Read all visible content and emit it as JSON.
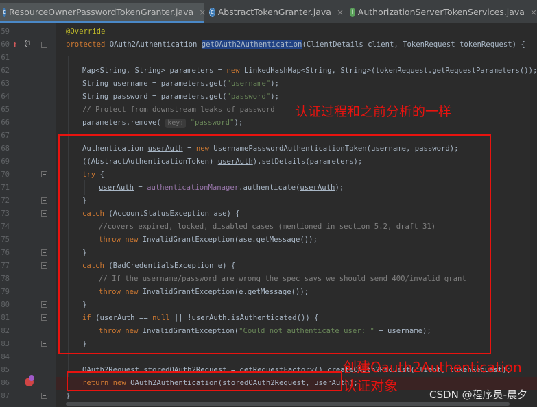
{
  "tabs": [
    {
      "label": "ResourceOwnerPasswordTokenGranter.java",
      "icon": "java-class-icon",
      "active": true
    },
    {
      "label": "AbstractTokenGranter.java",
      "icon": "java-abstract-class-icon",
      "active": false
    },
    {
      "label": "AuthorizationServerTokenServices.java",
      "icon": "java-interface-icon",
      "active": false
    }
  ],
  "close_glyph": "×",
  "line_numbers": [
    "59",
    "60",
    "61",
    "62",
    "63",
    "64",
    "65",
    "66",
    "67",
    "68",
    "69",
    "70",
    "71",
    "72",
    "73",
    "74",
    "75",
    "76",
    "77",
    "78",
    "79",
    "80",
    "81",
    "82",
    "83",
    "84",
    "85",
    "86",
    "87"
  ],
  "code": {
    "l59": "@Override",
    "l60_kw": "protected",
    "l60_type": " OAuth2Authentication ",
    "l60_method": "getOAuth2Authentication",
    "l60_rest": "(ClientDetails client, TokenRequest tokenRequest) {",
    "l62_a": "Map<String, String> parameters = ",
    "l62_kw": "new",
    "l62_b": " LinkedHashMap<String, String>(tokenRequest.getRequestParameters());",
    "l63_a": "String username = parameters.get(",
    "l63_str": "\"username\"",
    "l63_b": ");",
    "l64_a": "String password = parameters.get(",
    "l64_str": "\"password\"",
    "l64_b": ");",
    "l65_cmt": "// Protect from downstream leaks of password",
    "l66_a": "parameters.remove( ",
    "l66_hint": "key:",
    "l66_str": " \"password\"",
    "l66_b": ");",
    "l68_a": "Authentication ",
    "l68_var": "userAuth",
    "l68_b": " = ",
    "l68_kw": "new",
    "l68_c": " UsernamePasswordAuthenticationToken(username, password);",
    "l69_a": "((AbstractAuthenticationToken) ",
    "l69_var": "userAuth",
    "l69_b": ").setDetails(parameters);",
    "l70_kw": "try",
    "l70_b": " {",
    "l71_var": "userAuth",
    "l71_a": " = ",
    "l71_fld": "authenticationManager",
    "l71_b": ".authenticate(",
    "l71_var2": "userAuth",
    "l71_c": ");",
    "l72": "}",
    "l73_kw": "catch",
    "l73_b": " (AccountStatusException ase) {",
    "l74_cmt": "//covers expired, locked, disabled cases (mentioned in section 5.2, draft 31)",
    "l75_kw": "throw new",
    "l75_b": " InvalidGrantException(ase.getMessage());",
    "l76": "}",
    "l77_kw": "catch",
    "l77_b": " (BadCredentialsException e) {",
    "l78_cmt": "// If the username/password are wrong the spec says we should send 400/invalid grant",
    "l79_kw": "throw new",
    "l79_b": " InvalidGrantException(e.getMessage());",
    "l80": "}",
    "l81_kw": "if",
    "l81_a": " (",
    "l81_var": "userAuth",
    "l81_b": " == ",
    "l81_kw2": "null",
    "l81_c": " || !",
    "l81_var2": "userAuth",
    "l81_d": ".isAuthenticated()) {",
    "l82_kw": "throw new",
    "l82_a": " InvalidGrantException(",
    "l82_str": "\"Could not authenticate user: \"",
    "l82_b": " + username);",
    "l83": "}",
    "l85": "OAuth2Request storedOAuth2Request = getRequestFactory().createOAuth2Request(client, tokenRequest);",
    "l86_kw": "return new",
    "l86_a": " OAuth2Authentication(storedOAuth2Request, ",
    "l86_var": "userAuth",
    "l86_b": ");",
    "l87": "}"
  },
  "annotations": {
    "note1": "认证过程和之前分析的一样",
    "note2_line1": "创建Oauth2Authentication",
    "note2_line2": "认证对象",
    "watermark": "CSDN @程序员-晨夕"
  },
  "colors": {
    "background": "#2B2B2B",
    "keyword": "#CC7832",
    "string": "#6A8759",
    "comment": "#808080",
    "field": "#9876AA",
    "annotation_red": "#E8130F"
  }
}
